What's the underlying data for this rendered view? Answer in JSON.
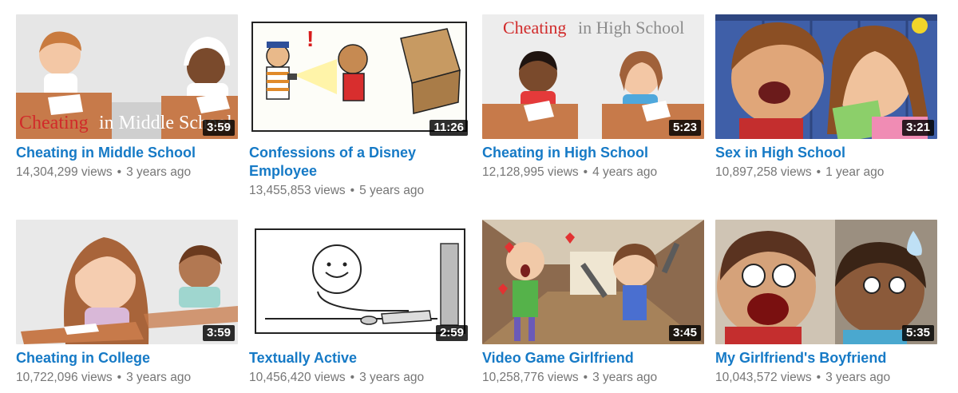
{
  "videos": [
    {
      "title": "Cheating in Middle School",
      "views": "14,304,299 views",
      "age": "3 years ago",
      "duration": "3:59",
      "thumb_caption_a": "Cheating",
      "thumb_caption_b": "in Middle School"
    },
    {
      "title": "Confessions of a Disney Employee",
      "views": "13,455,853 views",
      "age": "5 years ago",
      "duration": "11:26"
    },
    {
      "title": "Cheating in High School",
      "views": "12,128,995 views",
      "age": "4 years ago",
      "duration": "5:23",
      "thumb_caption_a": "Cheating",
      "thumb_caption_b": "in High School"
    },
    {
      "title": "Sex in High School",
      "views": "10,897,258 views",
      "age": "1 year ago",
      "duration": "3:21"
    },
    {
      "title": "Cheating in College",
      "views": "10,722,096 views",
      "age": "3 years ago",
      "duration": "3:59"
    },
    {
      "title": "Textually Active",
      "views": "10,456,420 views",
      "age": "3 years ago",
      "duration": "2:59"
    },
    {
      "title": "Video Game Girlfriend",
      "views": "10,258,776 views",
      "age": "3 years ago",
      "duration": "3:45"
    },
    {
      "title": "My Girlfriend's Boyfriend",
      "views": "10,043,572 views",
      "age": "3 years ago",
      "duration": "5:35"
    }
  ],
  "separator": "•",
  "colors": {
    "title_link": "#167ac6",
    "meta_text": "#767676",
    "duration_bg": "#000000"
  }
}
